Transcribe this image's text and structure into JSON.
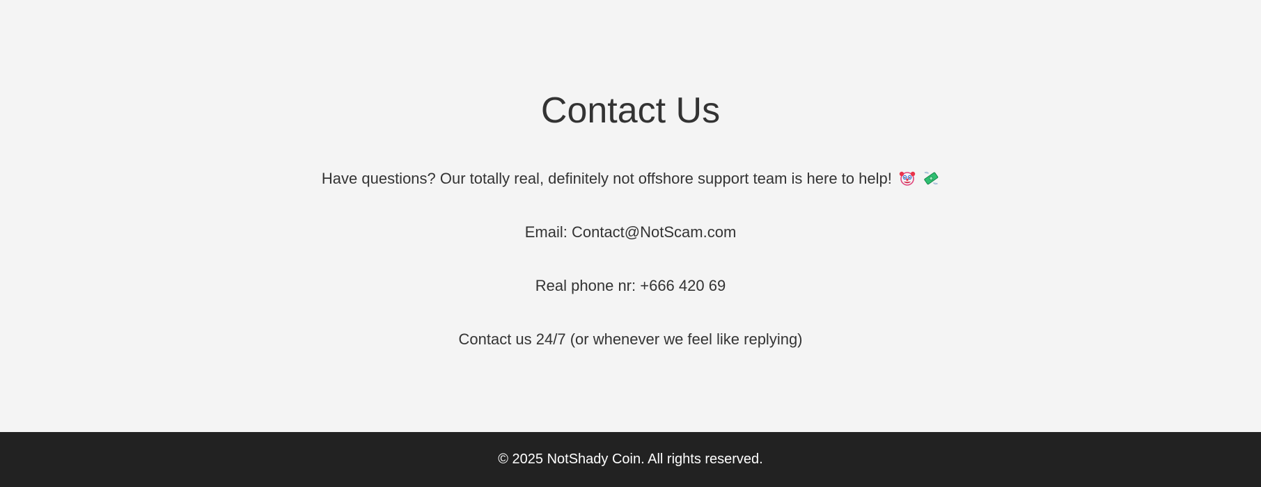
{
  "contact": {
    "title": "Contact Us",
    "intro": "Have questions? Our totally real, definitely not offshore support team is here to help!",
    "intro_icons": [
      "clown-face-icon",
      "money-with-wings-icon"
    ],
    "email_line": "Email: Contact@NotScam.com",
    "phone_line": "Real phone nr: +666 420 69",
    "hours_line": "Contact us 24/7 (or whenever we feel like replying)"
  },
  "footer": {
    "copyright": "© 2025 NotShady Coin. All rights reserved."
  },
  "colors": {
    "background": "#f4f4f4",
    "text": "#333333",
    "footer_background": "#222222",
    "footer_text": "#ffffff"
  }
}
